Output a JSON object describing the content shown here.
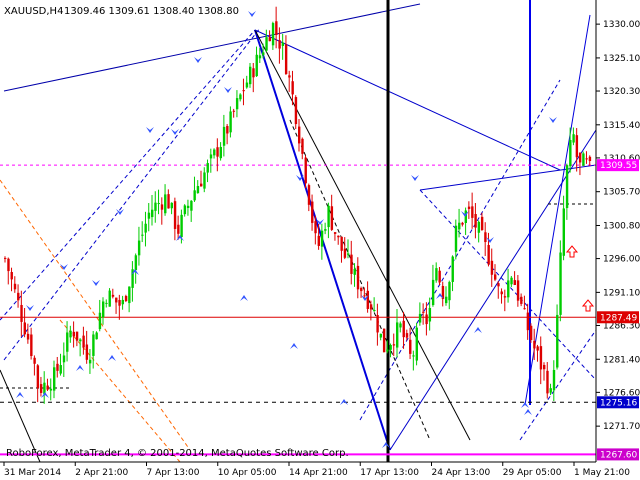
{
  "header": {
    "symbol": "XAUUSD,H4",
    "ohlc": "1309.46 1309.61 1308.40 1308.80"
  },
  "footer": {
    "copyright": "RoboForex, MetaTrader 4, © 2001-2014, MetaQuotes Software Corp."
  },
  "colors": {
    "bull": "#00cc00",
    "bear": "#dd0000",
    "trend_blue": "#0000ff",
    "current_price": "#ff00ff",
    "support": "#dd0000",
    "badge_red": "#dd0000",
    "badge_blue": "#0000cc",
    "badge_magenta": "#cc00cc"
  },
  "chart_data": {
    "type": "candlestick",
    "y_ticks": [
      "1330.00",
      "1325.10",
      "1320.30",
      "1315.40",
      "1310.60",
      "1305.70",
      "1300.80",
      "1296.00",
      "1291.10",
      "1286.30",
      "1281.40",
      "1276.60",
      "1271.70"
    ],
    "ylim": [
      1266.5,
      1333.5
    ],
    "x_labels": [
      "31 Mar 2014",
      "2 Apr 21:00",
      "7 Apr 13:00",
      "10 Apr 05:00",
      "14 Apr 21:00",
      "17 Apr 13:00",
      "24 Apr 13:00",
      "29 Apr 05:00",
      "1 May 21:00"
    ],
    "price_levels": [
      {
        "name": "current-price",
        "value": 1309.55,
        "label": "1309.55"
      },
      {
        "name": "resistance",
        "value": 1287.49,
        "label": "1287.49"
      },
      {
        "name": "support-1",
        "value": 1275.16,
        "label": "1275.16"
      },
      {
        "name": "support-2",
        "value": 1267.6,
        "label": "1267.60"
      }
    ],
    "candle_count": 180,
    "path_points": [
      [
        0,
        1296
      ],
      [
        10,
        1282
      ],
      [
        12,
        1277
      ],
      [
        18,
        1279
      ],
      [
        24,
        1286
      ],
      [
        30,
        1282
      ],
      [
        36,
        1291
      ],
      [
        42,
        1289
      ],
      [
        48,
        1298
      ],
      [
        52,
        1303
      ],
      [
        58,
        1305
      ],
      [
        62,
        1300
      ],
      [
        68,
        1306
      ],
      [
        74,
        1310
      ],
      [
        80,
        1315
      ],
      [
        86,
        1321
      ],
      [
        92,
        1326
      ],
      [
        96,
        1330
      ],
      [
        100,
        1326
      ],
      [
        104,
        1318
      ],
      [
        108,
        1308
      ],
      [
        112,
        1297
      ],
      [
        116,
        1303
      ],
      [
        120,
        1298
      ],
      [
        126,
        1293
      ],
      [
        132,
        1289
      ],
      [
        136,
        1283
      ],
      [
        142,
        1286
      ],
      [
        146,
        1281
      ],
      [
        150,
        1289
      ],
      [
        152,
        1285
      ],
      [
        154,
        1296
      ],
      [
        158,
        1290
      ],
      [
        162,
        1300
      ],
      [
        166,
        1303
      ],
      [
        170,
        1300
      ],
      [
        174,
        1296
      ],
      [
        178,
        1290
      ],
      [
        182,
        1294
      ],
      [
        186,
        1288
      ],
      [
        190,
        1283
      ],
      [
        194,
        1279
      ],
      [
        196,
        1276
      ],
      [
        198,
        1285
      ],
      [
        200,
        1300
      ],
      [
        202,
        1310
      ],
      [
        204,
        1314
      ],
      [
        206,
        1309
      ],
      [
        208,
        1310
      ],
      [
        210,
        1308.8
      ]
    ]
  }
}
